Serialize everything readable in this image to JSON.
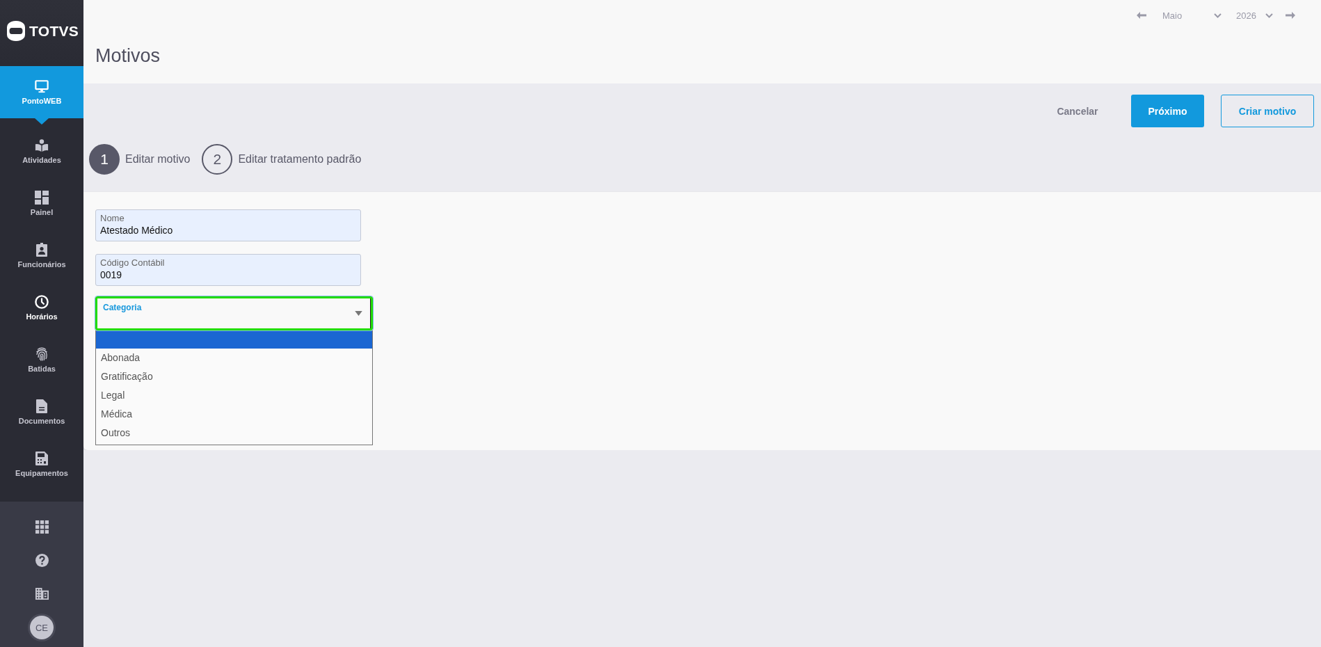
{
  "sidebar": {
    "logo": {
      "text": "TOTVS"
    },
    "items": [
      {
        "label": "PontoWEB",
        "selected": true,
        "hovered": false
      },
      {
        "label": "Atividades",
        "selected": false,
        "hovered": false
      },
      {
        "label": "Painel",
        "selected": false,
        "hovered": false
      },
      {
        "label": "Funcionários",
        "selected": false,
        "hovered": false
      },
      {
        "label": "Horários",
        "selected": false,
        "hovered": true
      },
      {
        "label": "Batidas",
        "selected": false,
        "hovered": false
      },
      {
        "label": "Documentos",
        "selected": false,
        "hovered": false
      },
      {
        "label": "Equipamentos",
        "selected": false,
        "hovered": false
      }
    ],
    "avatar": {
      "initials": "CE"
    }
  },
  "header": {
    "title": "Motivos",
    "date_nav": {
      "month": "Maio",
      "year": "2026"
    }
  },
  "actions": [
    {
      "label": "Cancelar",
      "kind": "text"
    },
    {
      "label": "Próximo",
      "kind": "primary"
    },
    {
      "label": "Criar motivo",
      "kind": "outline"
    }
  ],
  "steps": [
    {
      "number": "1",
      "label": "Editar motivo",
      "selected": true
    },
    {
      "number": "2",
      "label": "Editar tratamento padrão",
      "selected": false
    }
  ],
  "form": {
    "fields": [
      {
        "label": "Nome",
        "value": "Atestado Médico"
      },
      {
        "label": "Código Contábil",
        "value": "0019"
      }
    ],
    "category": {
      "label": "Categoria",
      "focused": true,
      "expanded": true,
      "blank_option_highlighted": true,
      "options": [
        {
          "label": "Abonada",
          "highlighted": false
        },
        {
          "label": "Gratificação",
          "highlighted": false
        },
        {
          "label": "Legal",
          "highlighted": false
        },
        {
          "label": "Médica",
          "highlighted": false
        },
        {
          "label": "Outros",
          "highlighted": false
        }
      ]
    }
  }
}
